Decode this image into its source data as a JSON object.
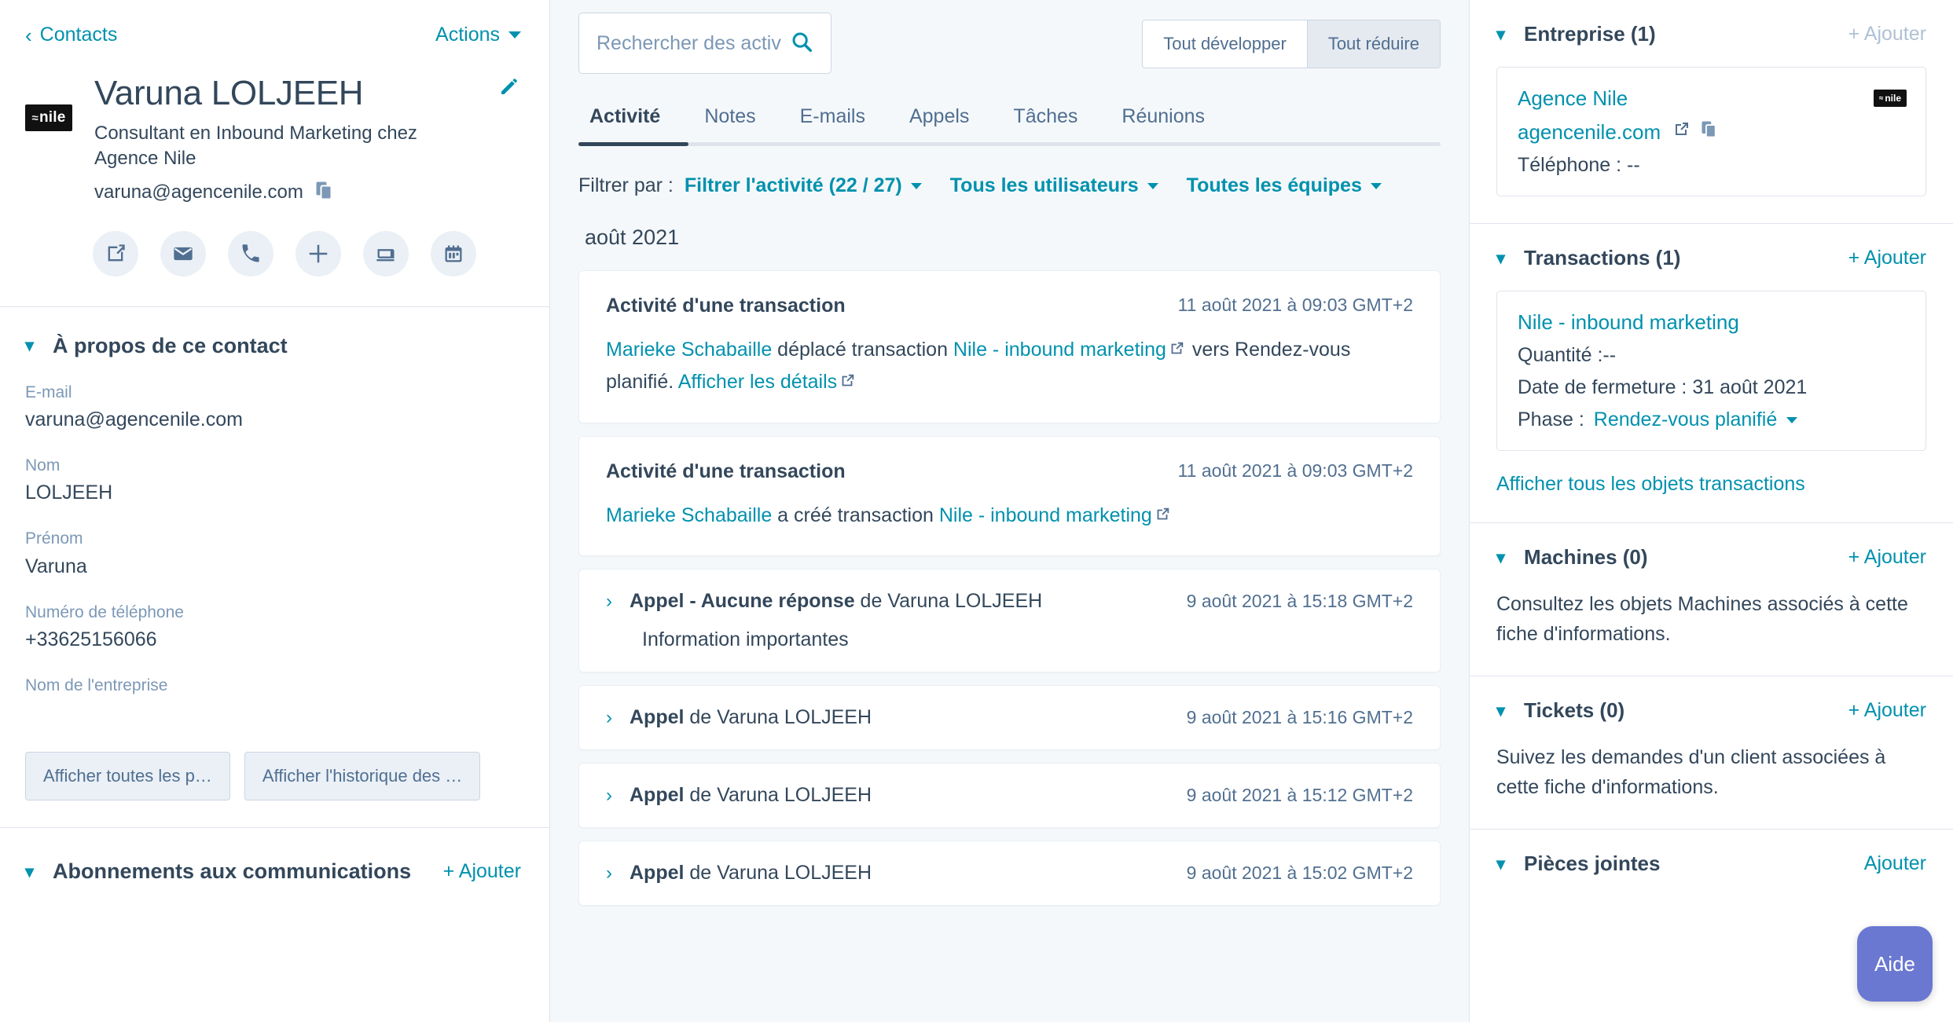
{
  "left": {
    "breadcrumb": "Contacts",
    "actions_label": "Actions",
    "contact": {
      "name": "Varuna LOLJEEH",
      "job_title": "Consultant en Inbound Marketing chez Agence Nile",
      "email": "varuna@agencenile.com",
      "logo_text": "nile"
    },
    "action_icons": [
      {
        "name": "note-icon"
      },
      {
        "name": "email-icon"
      },
      {
        "name": "call-icon"
      },
      {
        "name": "plus-icon"
      },
      {
        "name": "task-icon"
      },
      {
        "name": "meeting-icon"
      }
    ],
    "about": {
      "title": "À propos de ce contact",
      "properties": [
        {
          "label": "E-mail",
          "value": "varuna@agencenile.com"
        },
        {
          "label": "Nom",
          "value": "LOLJEEH"
        },
        {
          "label": "Prénom",
          "value": "Varuna"
        },
        {
          "label": "Numéro de téléphone",
          "value": "+33625156066"
        },
        {
          "label": "Nom de l'entreprise",
          "value": ""
        }
      ],
      "buttons": [
        "Afficher toutes les p…",
        "Afficher l'historique des …"
      ]
    },
    "subscriptions": {
      "title": "Abonnements aux communications",
      "add_label": "+ Ajouter"
    }
  },
  "center": {
    "search": {
      "placeholder": "Rechercher des activités",
      "value": ""
    },
    "toggles": [
      {
        "label": "Tout développer",
        "active": false
      },
      {
        "label": "Tout réduire",
        "active": true
      }
    ],
    "tabs": [
      {
        "label": "Activité",
        "active": true
      },
      {
        "label": "Notes",
        "active": false
      },
      {
        "label": "E-mails",
        "active": false
      },
      {
        "label": "Appels",
        "active": false
      },
      {
        "label": "Tâches",
        "active": false
      },
      {
        "label": "Réunions",
        "active": false
      }
    ],
    "filters": {
      "label": "Filtrer par :",
      "items": [
        "Filtrer l'activité (22 / 27)",
        "Tous les utilisateurs",
        "Toutes les équipes"
      ]
    },
    "month_label": "août 2021",
    "activities": [
      {
        "kind": "deal",
        "title": "Activité d'une transaction",
        "time": "11 août 2021 à 09:03 GMT+2",
        "actor": "Marieke Schabaille",
        "text_1": " déplacé transaction ",
        "object": "Nile - inbound marketing",
        "text_2": " vers Rendez-vous planifié. ",
        "detail_link": "Afficher les détails"
      },
      {
        "kind": "deal",
        "title": "Activité d'une transaction",
        "time": "11 août 2021 à 09:03 GMT+2",
        "actor": "Marieke Schabaille",
        "text_1": " a créé transaction ",
        "object": "Nile - inbound marketing",
        "text_2": "",
        "detail_link": ""
      },
      {
        "kind": "call",
        "bold": "Appel - Aucune réponse",
        "rest": " de Varuna LOLJEEH",
        "time": "9 août 2021 à 15:18 GMT+2",
        "note": "Information importantes"
      },
      {
        "kind": "call",
        "bold": "Appel",
        "rest": " de Varuna LOLJEEH",
        "time": "9 août 2021 à 15:16 GMT+2",
        "note": ""
      },
      {
        "kind": "call",
        "bold": "Appel",
        "rest": " de Varuna LOLJEEH",
        "time": "9 août 2021 à 15:12 GMT+2",
        "note": ""
      },
      {
        "kind": "call",
        "bold": "Appel",
        "rest": " de Varuna LOLJEEH",
        "time": "9 août 2021 à 15:02 GMT+2",
        "note": ""
      }
    ]
  },
  "right": {
    "company": {
      "title": "Entreprise (1)",
      "add_label": "+ Ajouter",
      "name": "Agence Nile",
      "website": "agencenile.com",
      "phone_line": "Téléphone : --",
      "logo_text": "nile"
    },
    "deals": {
      "title": "Transactions (1)",
      "add_label": "+ Ajouter",
      "name": "Nile - inbound marketing",
      "quantity_line": "Quantité :--",
      "close_date_line": "Date de fermeture : 31 août 2021",
      "phase_label": "Phase :",
      "phase_value": "Rendez-vous planifié",
      "view_all": "Afficher tous les objets transactions"
    },
    "machines": {
      "title": "Machines (0)",
      "add_label": "+ Ajouter",
      "empty": "Consultez les objets Machines associés à cette fiche d'informations."
    },
    "tickets": {
      "title": "Tickets (0)",
      "add_label": "+ Ajouter",
      "empty": "Suivez les demandes d'un client associées à cette fiche d'informations."
    },
    "attachments": {
      "title": "Pièces jointes",
      "add_label": "Ajouter"
    },
    "help_fab": "Aide"
  },
  "colors": {
    "accent": "#0091ae",
    "text": "#33475b",
    "muted": "#7c98b6",
    "bg": "#f5f8fa",
    "border": "#dfe3eb",
    "help": "#6a78d1"
  }
}
